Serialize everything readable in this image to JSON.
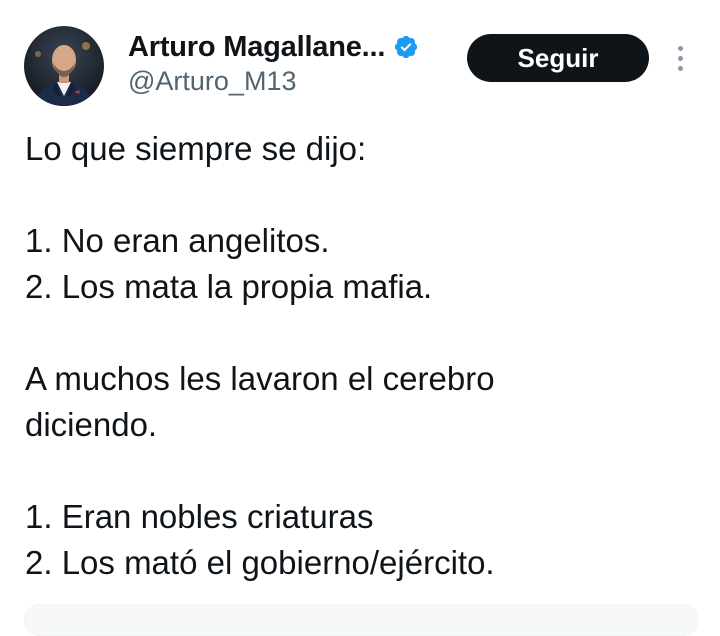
{
  "author": {
    "display_name": "Arturo Magallane...",
    "handle": "@Arturo_M13",
    "verified": true,
    "avatar_icon": "profile-photo-avatar"
  },
  "actions": {
    "follow_label": "Seguir",
    "more_icon": "more-vertical-icon"
  },
  "tweet": {
    "lines": [
      "Lo que siempre se dijo:",
      "",
      "1. No eran angelitos.",
      "2. Los mata la propia mafia.",
      "",
      "A muchos les lavaron el cerebro",
      "diciendo.",
      "",
      "1. Eran nobles criaturas",
      "2. Los mató el gobierno/ejército."
    ]
  },
  "colors": {
    "verified_badge": "#1d9bf0",
    "follow_button_bg": "#0f1419",
    "secondary_text": "#536471"
  }
}
